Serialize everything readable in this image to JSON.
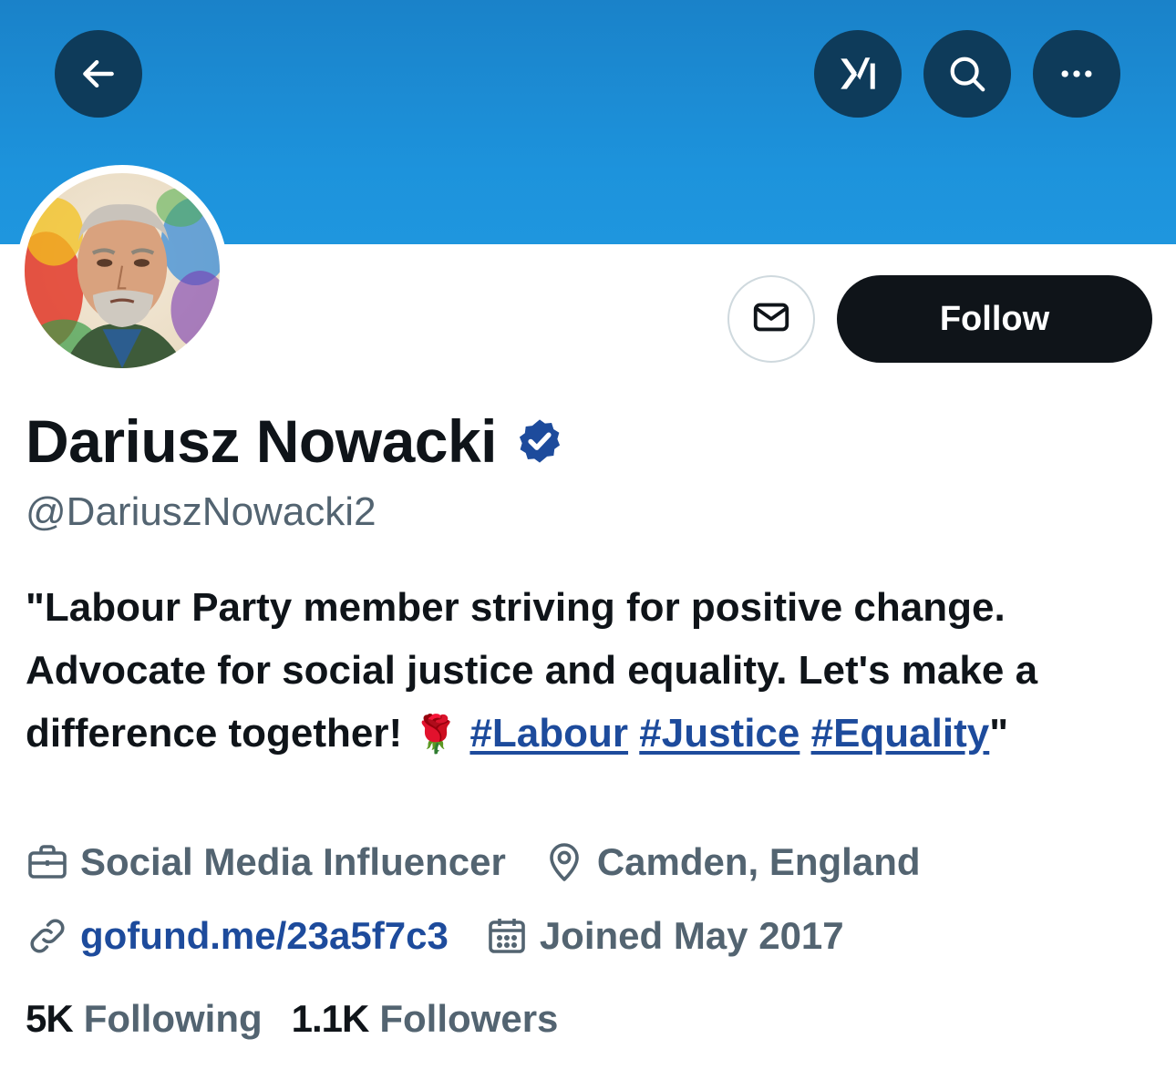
{
  "profile": {
    "display_name": "Dariusz Nowacki",
    "handle": "@DariuszNowacki2",
    "verified": true
  },
  "actions": {
    "follow_label": "Follow"
  },
  "bio": {
    "text": "\"Labour Party member striving for positive change. Advocate for social justice and equality. Let's make a difference together!",
    "emoji": "🌹",
    "hashtags": [
      "#Labour",
      "#Justice",
      "#Equality"
    ],
    "closing": "\""
  },
  "meta": {
    "profession": "Social Media Influencer",
    "location": "Camden, England",
    "website": "gofund.me/23a5f7c3",
    "joined": "Joined May 2017"
  },
  "stats": {
    "following_count": "5K",
    "following_label": "Following",
    "followers_count": "1.1K",
    "followers_label": "Followers"
  },
  "icons": [
    "back-arrow-icon",
    "grok-icon",
    "search-icon",
    "more-icon",
    "message-icon",
    "verified-badge-icon",
    "briefcase-icon",
    "location-pin-icon",
    "link-icon",
    "calendar-icon"
  ],
  "colors": {
    "banner": "#1d93dc",
    "top_button_bg": "#0e3b5a",
    "follow_button_bg": "#0f1419",
    "link": "#1d4b9c",
    "secondary_text": "#536471",
    "verified_badge": "#1d4b9c"
  }
}
